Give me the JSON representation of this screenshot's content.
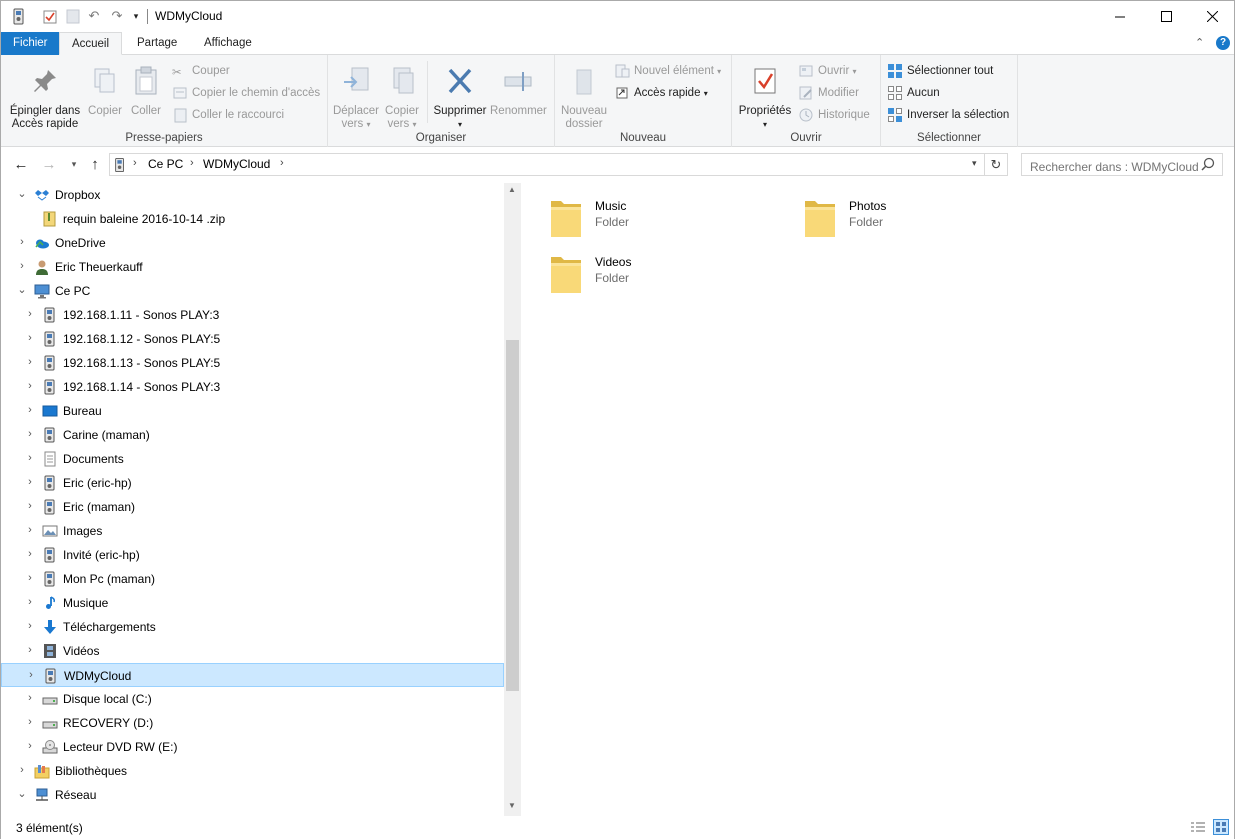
{
  "window": {
    "title": "WDMyCloud"
  },
  "tabs": {
    "file": "Fichier",
    "home": "Accueil",
    "share": "Partage",
    "view": "Affichage"
  },
  "ribbon": {
    "clipboard": {
      "pin_line1": "Épingler dans",
      "pin_line2": "Accès rapide",
      "copy": "Copier",
      "paste": "Coller",
      "cut": "Couper",
      "copy_path": "Copier le chemin d'accès",
      "paste_shortcut": "Coller le raccourci",
      "label": "Presse-papiers"
    },
    "organize": {
      "move_line1": "Déplacer",
      "move_line2": "vers",
      "copy_line1": "Copier",
      "copy_line2": "vers",
      "delete": "Supprimer",
      "rename": "Renommer",
      "label": "Organiser"
    },
    "new": {
      "folder_line1": "Nouveau",
      "folder_line2": "dossier",
      "new_item": "Nouvel élément",
      "quick_access": "Accès rapide",
      "label": "Nouveau"
    },
    "open": {
      "properties": "Propriétés",
      "open": "Ouvrir",
      "edit": "Modifier",
      "history": "Historique",
      "label": "Ouvrir"
    },
    "select": {
      "select_all": "Sélectionner tout",
      "none": "Aucun",
      "invert": "Inverser la sélection",
      "label": "Sélectionner"
    }
  },
  "address": {
    "crumbs": [
      "Ce PC",
      "WDMyCloud"
    ]
  },
  "search": {
    "placeholder": "Rechercher dans : WDMyCloud"
  },
  "nav": {
    "items": [
      {
        "label": "Dropbox",
        "icon": "dropbox-icon",
        "expanded": true
      },
      {
        "label": "requin baleine 2016-10-14 .zip",
        "icon": "zip-icon"
      },
      {
        "label": "OneDrive",
        "icon": "onedrive-icon"
      },
      {
        "label": "Eric Theuerkauff",
        "icon": "user-icon"
      },
      {
        "label": "Ce PC",
        "icon": "computer-icon",
        "expanded": true
      },
      {
        "label": "192.168.1.11 - Sonos PLAY:3",
        "icon": "media-device-icon"
      },
      {
        "label": "192.168.1.12 - Sonos PLAY:5",
        "icon": "media-device-icon"
      },
      {
        "label": "192.168.1.13 - Sonos PLAY:5",
        "icon": "media-device-icon"
      },
      {
        "label": "192.168.1.14 - Sonos PLAY:3",
        "icon": "media-device-icon"
      },
      {
        "label": "Bureau",
        "icon": "desktop-icon"
      },
      {
        "label": "Carine (maman)",
        "icon": "media-device-icon"
      },
      {
        "label": "Documents",
        "icon": "documents-icon"
      },
      {
        "label": "Eric (eric-hp)",
        "icon": "media-device-icon"
      },
      {
        "label": "Eric (maman)",
        "icon": "media-device-icon"
      },
      {
        "label": "Images",
        "icon": "images-icon"
      },
      {
        "label": "Invité (eric-hp)",
        "icon": "media-device-icon"
      },
      {
        "label": "Mon Pc (maman)",
        "icon": "media-device-icon"
      },
      {
        "label": "Musique",
        "icon": "music-icon"
      },
      {
        "label": "Téléchargements",
        "icon": "downloads-icon"
      },
      {
        "label": "Vidéos",
        "icon": "videos-icon"
      },
      {
        "label": "WDMyCloud",
        "icon": "media-device-icon",
        "selected": true
      },
      {
        "label": "Disque local (C:)",
        "icon": "drive-icon"
      },
      {
        "label": "RECOVERY (D:)",
        "icon": "drive-icon"
      },
      {
        "label": "Lecteur DVD RW (E:)",
        "icon": "dvd-icon"
      },
      {
        "label": "Bibliothèques",
        "icon": "libraries-icon"
      },
      {
        "label": "Réseau",
        "icon": "network-icon",
        "expanded": true
      }
    ]
  },
  "content": {
    "items": [
      {
        "name": "Music",
        "type": "Folder"
      },
      {
        "name": "Photos",
        "type": "Folder"
      },
      {
        "name": "Videos",
        "type": "Folder"
      }
    ]
  },
  "status": {
    "count": "3 élément(s)"
  },
  "colors": {
    "accent": "#1979ca",
    "selection": "#cce8ff",
    "folder": "#f7d774"
  }
}
